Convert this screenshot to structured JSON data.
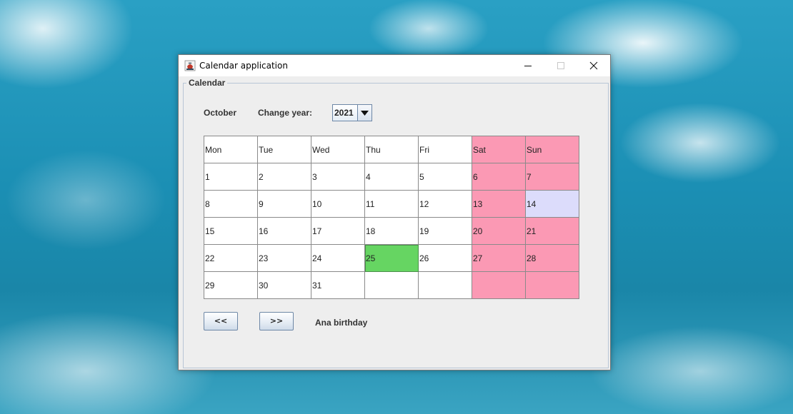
{
  "window": {
    "title": "Calendar application",
    "icons": {
      "app": "java-cup-icon",
      "minimize": "minimize-icon",
      "maximize": "maximize-icon",
      "close": "close-icon"
    }
  },
  "panel": {
    "legend": "Calendar"
  },
  "header": {
    "month": "October",
    "change_year_label": "Change year:",
    "year_value": "2021"
  },
  "calendar": {
    "days": [
      "Mon",
      "Tue",
      "Wed",
      "Thu",
      "Fri",
      "Sat",
      "Sun"
    ],
    "weeks": [
      [
        "1",
        "2",
        "3",
        "4",
        "5",
        "6",
        "7"
      ],
      [
        "8",
        "9",
        "10",
        "11",
        "12",
        "13",
        "14"
      ],
      [
        "15",
        "16",
        "17",
        "18",
        "19",
        "20",
        "21"
      ],
      [
        "22",
        "23",
        "24",
        "25",
        "26",
        "27",
        "28"
      ],
      [
        "29",
        "30",
        "31",
        "",
        "",
        "",
        ""
      ]
    ],
    "colors": {
      "weekend": "#fb99b4",
      "today": "#dcdcfb",
      "event": "#66d562"
    }
  },
  "navigation": {
    "prev_label": "<<",
    "next_label": ">>"
  },
  "event_text": "Ana birthday"
}
